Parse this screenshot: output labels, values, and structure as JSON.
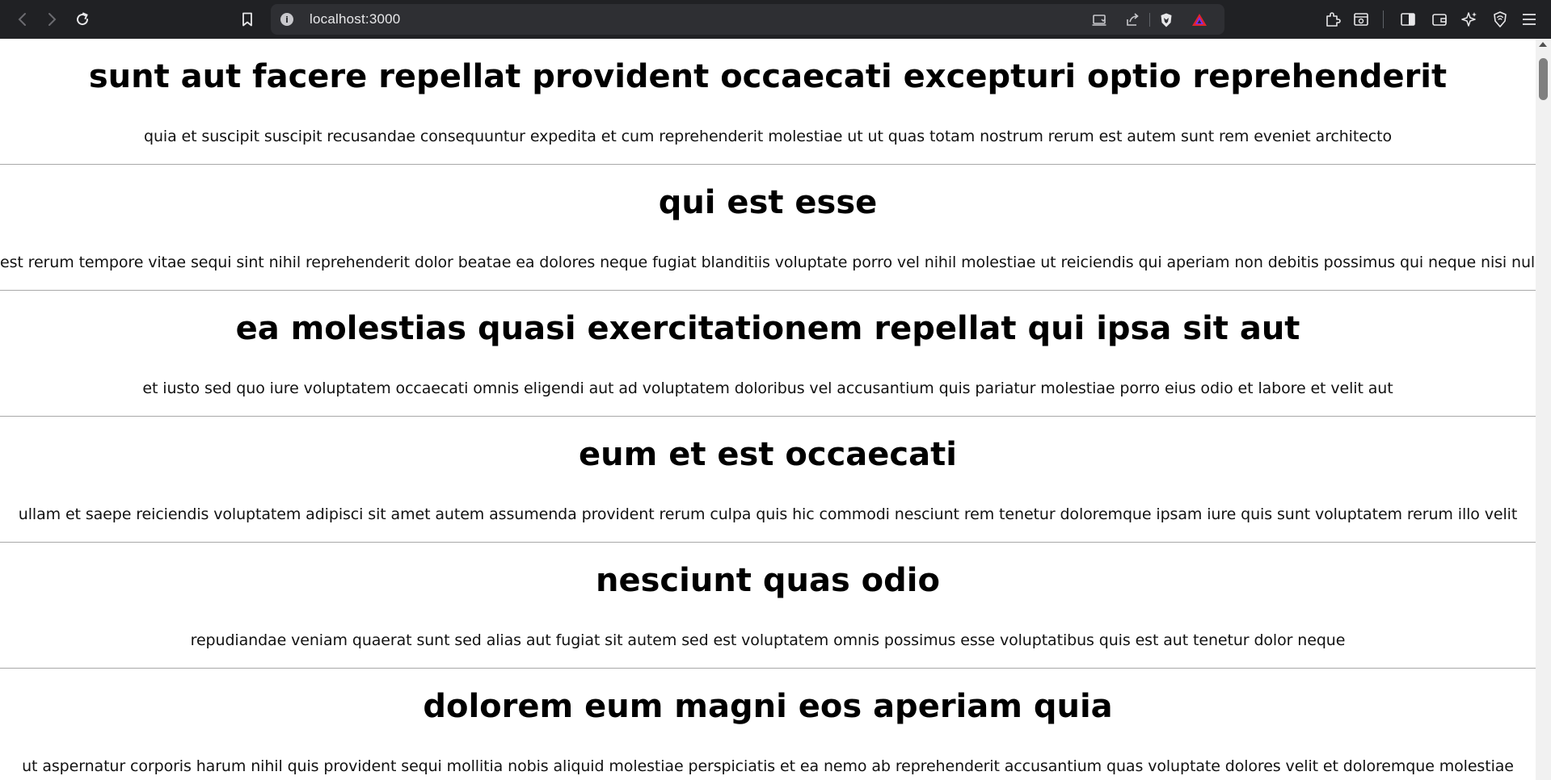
{
  "browser": {
    "url": "localhost:3000",
    "icons": {
      "back": "back-arrow-icon",
      "forward": "forward-arrow-icon",
      "reload": "reload-icon",
      "bookmark": "bookmark-icon",
      "site_info": "info-icon",
      "install": "install-app-icon",
      "share": "share-icon",
      "shields": "brave-shields-icon",
      "rewards": "brave-rewards-icon",
      "extensions": "extensions-icon",
      "reading_list": "reading-list-icon",
      "sidebar": "sidebar-icon",
      "wallet": "wallet-icon",
      "leo": "leo-ai-icon",
      "vpn": "vpn-icon",
      "menu": "menu-icon"
    },
    "colors": {
      "toolbar": "#202124",
      "urlbar": "#2e2f33",
      "rewards_accent": "#e1242b"
    }
  },
  "posts": [
    {
      "title": "sunt aut facere repellat provident occaecati excepturi optio reprehenderit",
      "body": "quia et suscipit suscipit recusandae consequuntur expedita et cum reprehenderit molestiae ut ut quas totam nostrum rerum est autem sunt rem eveniet architecto"
    },
    {
      "title": "qui est esse",
      "body": "est rerum tempore vitae sequi sint nihil reprehenderit dolor beatae ea dolores neque fugiat blanditiis voluptate porro vel nihil molestiae ut reiciendis qui aperiam non debitis possimus qui neque nisi nulla"
    },
    {
      "title": "ea molestias quasi exercitationem repellat qui ipsa sit aut",
      "body": "et iusto sed quo iure voluptatem occaecati omnis eligendi aut ad voluptatem doloribus vel accusantium quis pariatur molestiae porro eius odio et labore et velit aut"
    },
    {
      "title": "eum et est occaecati",
      "body": "ullam et saepe reiciendis voluptatem adipisci sit amet autem assumenda provident rerum culpa quis hic commodi nesciunt rem tenetur doloremque ipsam iure quis sunt voluptatem rerum illo velit"
    },
    {
      "title": "nesciunt quas odio",
      "body": "repudiandae veniam quaerat sunt sed alias aut fugiat sit autem sed est voluptatem omnis possimus esse voluptatibus quis est aut tenetur dolor neque"
    },
    {
      "title": "dolorem eum magni eos aperiam quia",
      "body": "ut aspernatur corporis harum nihil quis provident sequi mollitia nobis aliquid molestiae perspiciatis et ea nemo ab reprehenderit accusantium quas voluptate dolores velit et doloremque molestiae"
    }
  ]
}
